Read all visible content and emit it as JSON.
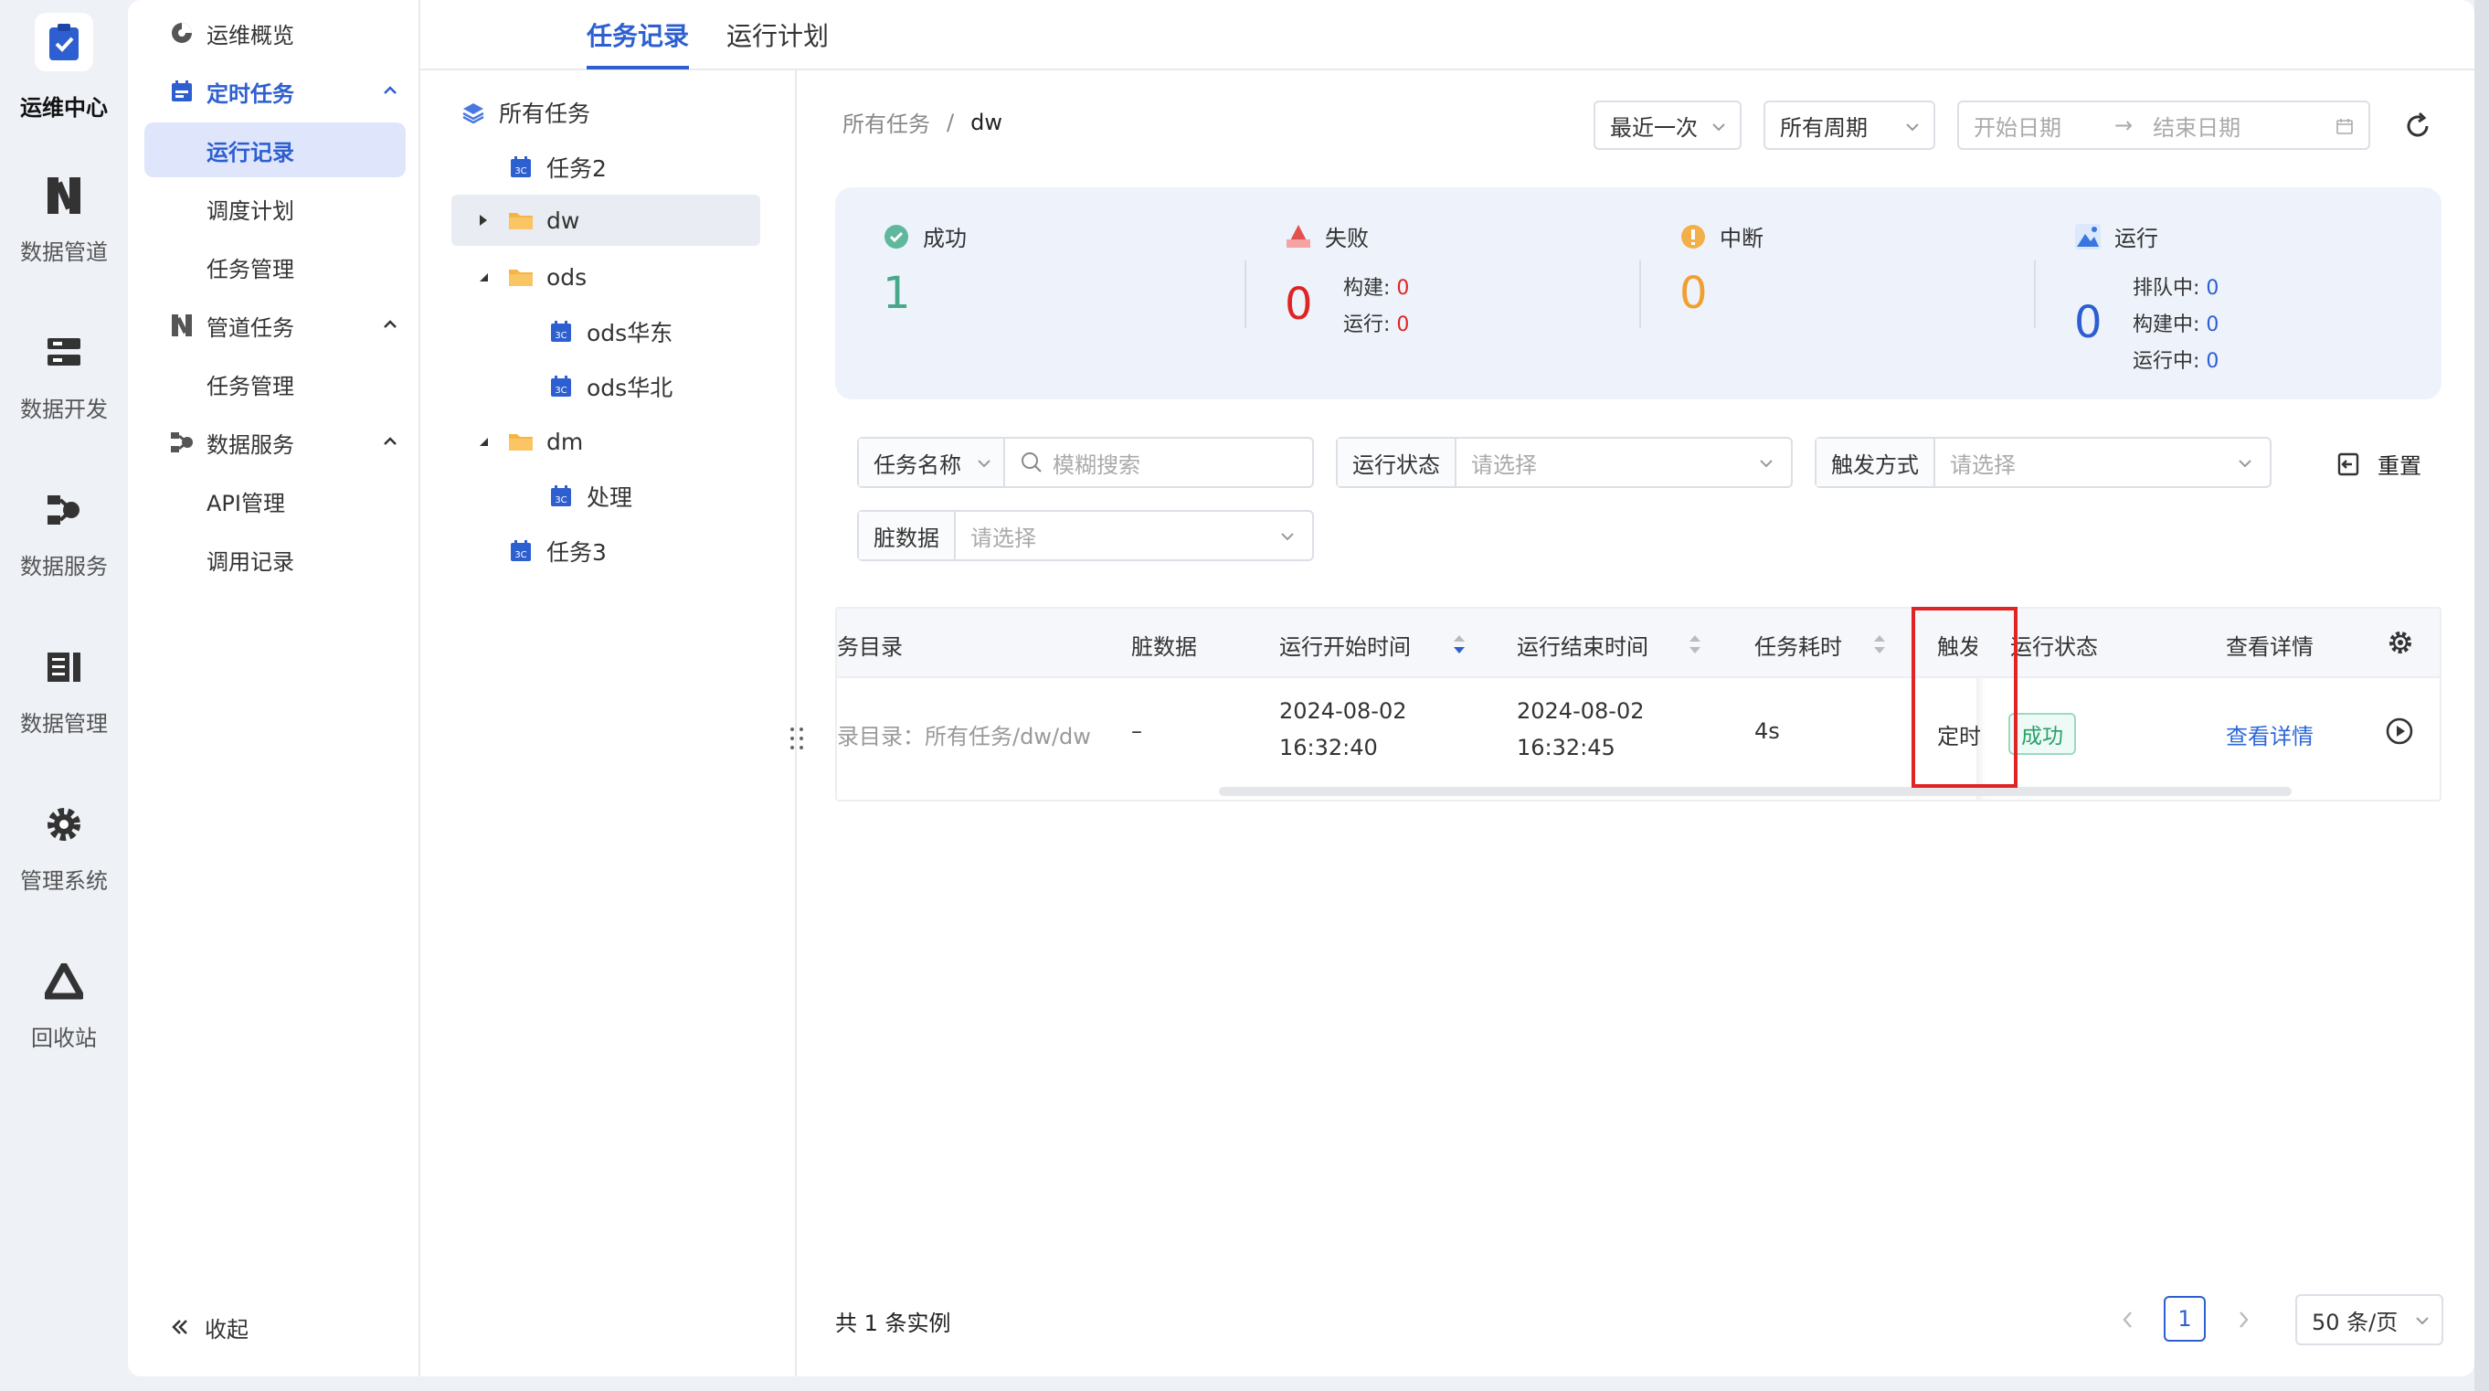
{
  "rail": {
    "items": [
      {
        "label": "运维中心",
        "icon": "clipboard-check-icon",
        "active": true
      },
      {
        "label": "数据管道",
        "icon": "pipeline-icon"
      },
      {
        "label": "数据开发",
        "icon": "server-stack-icon"
      },
      {
        "label": "数据服务",
        "icon": "service-hub-icon"
      },
      {
        "label": "数据管理",
        "icon": "ledger-icon"
      },
      {
        "label": "管理系统",
        "icon": "gear-icon"
      },
      {
        "label": "回收站",
        "icon": "recycle-icon"
      }
    ]
  },
  "menu": {
    "overview": "运维概览",
    "scheduled": {
      "label": "定时任务",
      "children": [
        "运行记录",
        "调度计划",
        "任务管理"
      ]
    },
    "pipeline": {
      "label": "管道任务",
      "children": [
        "任务管理"
      ]
    },
    "dataservice": {
      "label": "数据服务",
      "children": [
        "API管理",
        "调用记录"
      ]
    },
    "collapse": "收起"
  },
  "tabs": [
    "任务记录",
    "运行计划"
  ],
  "tree": {
    "root": "所有任务",
    "nodes": [
      "任务2",
      "dw",
      "ods",
      "ods华东",
      "ods华北",
      "dm",
      "处理",
      "任务3"
    ]
  },
  "breadcrumb": {
    "parent": "所有任务",
    "sep": "/",
    "current": "dw"
  },
  "controls": {
    "recent": "最近一次",
    "period": "所有周期",
    "start_placeholder": "开始日期",
    "arrow": "→",
    "end_placeholder": "结束日期"
  },
  "stats": {
    "success": {
      "title": "成功",
      "value": "1"
    },
    "fail": {
      "title": "失败",
      "value": "0",
      "build_label": "构建:",
      "build": "0",
      "run_label": "运行:",
      "run": "0"
    },
    "interrupt": {
      "title": "中断",
      "value": "0"
    },
    "running": {
      "title": "运行",
      "value": "0",
      "queue_label": "排队中:",
      "queue": "0",
      "build_label": "构建中:",
      "build": "0",
      "run_label": "运行中:",
      "run": "0"
    }
  },
  "filters": {
    "name_type": "任务名称",
    "search_placeholder": "模糊搜索",
    "status_label": "运行状态",
    "status_placeholder": "请选择",
    "trigger_label": "触发方式",
    "trigger_placeholder": "请选择",
    "reset": "重置",
    "dirty_label": "脏数据",
    "dirty_placeholder": "请选择"
  },
  "table": {
    "columns": [
      "务目录",
      "脏数据",
      "运行开始时间",
      "运行结束时间",
      "任务耗时",
      "触发",
      "运行状态",
      "查看详情"
    ],
    "rows": [
      {
        "dir": "录目录：所有任务/dw/dw",
        "dirty": "–",
        "start_date": "2024-08-02",
        "start_time": "16:32:40",
        "end_date": "2024-08-02",
        "end_time": "16:32:45",
        "duration": "4s",
        "trigger": "定时",
        "status": "成功",
        "detail": "查看详情"
      }
    ]
  },
  "footer": {
    "total": "共 1 条实例",
    "page": "1",
    "page_size": "50 条/页"
  },
  "colors": {
    "primary": "#2d5fd0",
    "success": "#27a06a",
    "danger": "#e02424",
    "warning": "#f0a030"
  }
}
